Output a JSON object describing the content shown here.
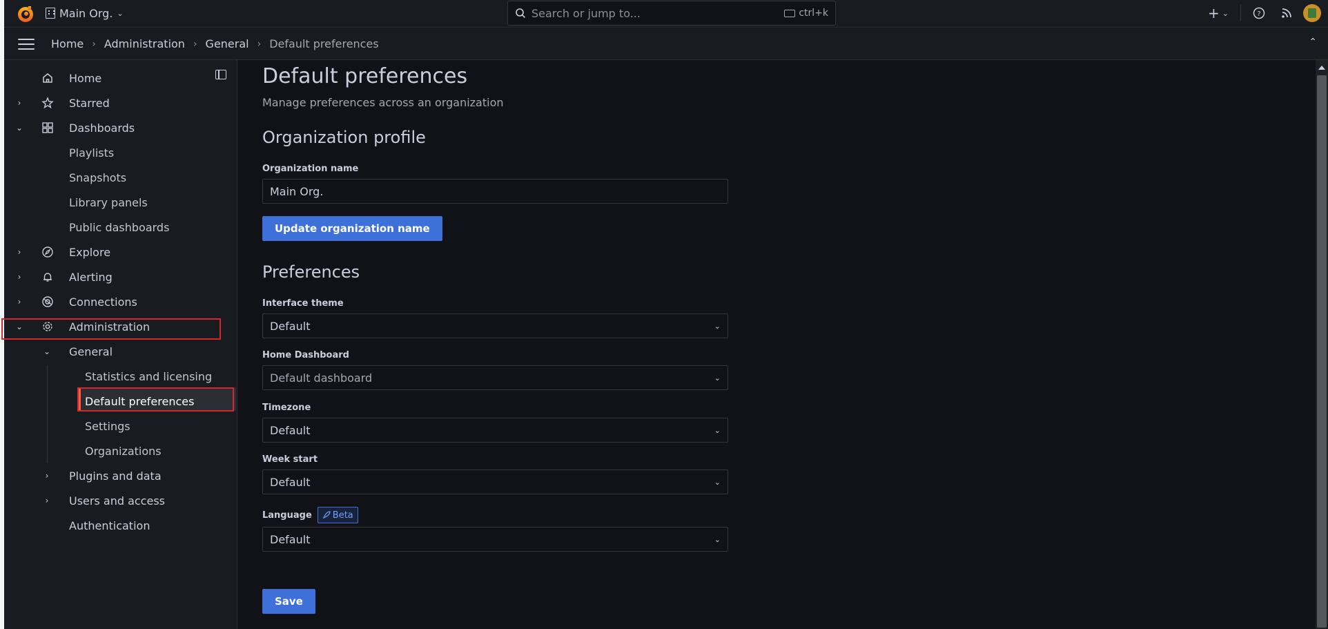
{
  "topbar": {
    "org_name": "Main Org.",
    "search_placeholder": "Search or jump to...",
    "search_shortcut": "ctrl+k",
    "icons": [
      "grafana-logo-icon",
      "building-icon",
      "plus-icon",
      "help-icon",
      "rss-icon",
      "avatar"
    ]
  },
  "breadcrumb": {
    "items": [
      "Home",
      "Administration",
      "General",
      "Default preferences"
    ]
  },
  "sidebar": {
    "items": [
      {
        "label": "Home",
        "icon": "home-icon"
      },
      {
        "label": "Starred",
        "icon": "star-icon"
      },
      {
        "label": "Dashboards",
        "icon": "dashboards-grid-icon"
      },
      {
        "label": "Playlists"
      },
      {
        "label": "Snapshots"
      },
      {
        "label": "Library panels"
      },
      {
        "label": "Public dashboards"
      },
      {
        "label": "Explore",
        "icon": "compass-icon"
      },
      {
        "label": "Alerting",
        "icon": "bell-icon"
      },
      {
        "label": "Connections",
        "icon": "connections-icon"
      },
      {
        "label": "Administration",
        "icon": "gear-icon"
      },
      {
        "label": "General"
      },
      {
        "label": "Statistics and licensing"
      },
      {
        "label": "Default preferences",
        "active": true
      },
      {
        "label": "Settings"
      },
      {
        "label": "Organizations"
      },
      {
        "label": "Plugins and data"
      },
      {
        "label": "Users and access"
      },
      {
        "label": "Authentication"
      }
    ]
  },
  "main": {
    "title": "Default preferences",
    "subtitle": "Manage preferences across an organization",
    "org_section": {
      "heading": "Organization profile",
      "name_label": "Organization name",
      "name_value": "Main Org.",
      "update_button": "Update organization name"
    },
    "prefs_section": {
      "heading": "Preferences",
      "theme_label": "Interface theme",
      "theme_value": "Default",
      "home_label": "Home Dashboard",
      "home_value": "Default dashboard",
      "timezone_label": "Timezone",
      "timezone_value": "Default",
      "week_label": "Week start",
      "week_value": "Default",
      "language_label": "Language",
      "language_badge": "Beta",
      "language_value": "Default",
      "save_button": "Save"
    }
  },
  "colors": {
    "accent_blue": "#3d71d9",
    "active_orange": "#f55f3e",
    "highlight_red": "#d3282d"
  }
}
